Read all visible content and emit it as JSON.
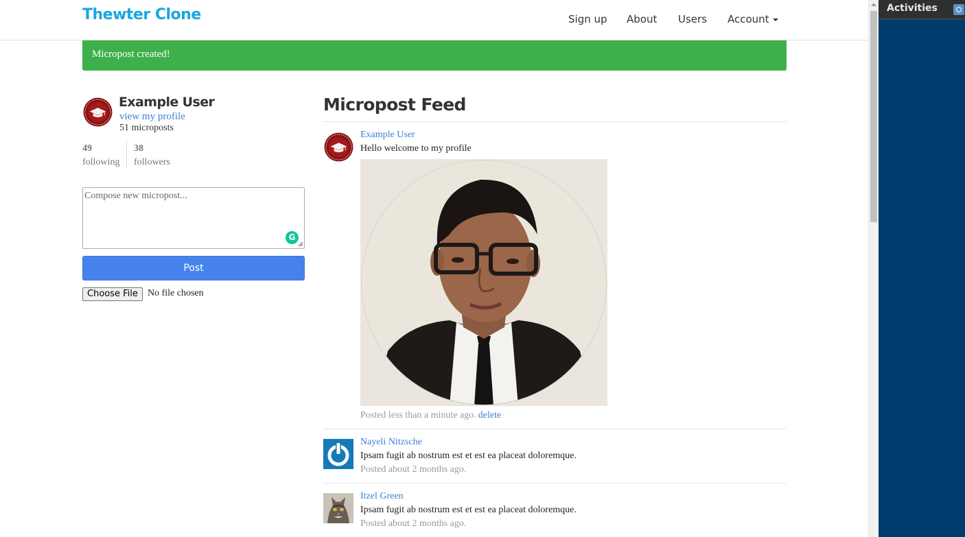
{
  "navbar": {
    "brand": "Thewter Clone",
    "links": {
      "signup": "Sign up",
      "about": "About",
      "users": "Users",
      "account": "Account"
    }
  },
  "alert": {
    "message": "Micropost created!"
  },
  "sidebar": {
    "user_name": "Example User",
    "profile_link": "view my profile",
    "micropost_count": "51 microposts",
    "following_count": "49",
    "following_label": "following",
    "followers_count": "38",
    "followers_label": "followers"
  },
  "composer": {
    "placeholder": "Compose new micropost...",
    "post_label": "Post",
    "choose_file_label": "Choose File",
    "file_status": "No file chosen"
  },
  "feed": {
    "title": "Micropost Feed",
    "items": [
      {
        "user": "Example User",
        "content": "Hello welcome to my profile",
        "time": "Posted less than a minute ago.",
        "delete_label": "delete",
        "has_image": true
      },
      {
        "user": "Nayeli Nitzsche",
        "content": "Ipsam fugit ab nostrum est et est ea placeat doloremque.",
        "time": "Posted about 2 months ago."
      },
      {
        "user": "Itzel Green",
        "content": "Ipsam fugit ab nostrum est et est ea placeat doloremque.",
        "time": "Posted about 2 months ago."
      }
    ]
  },
  "side_panel": {
    "title": "Activities"
  },
  "colors": {
    "brand": "#1aa7e0",
    "alert": "#3eb04b",
    "primary_button": "#4582ec",
    "link": "#3b80d5",
    "panel": "#003d6f"
  },
  "icons": {
    "user_avatar": "graduation-cap-badge-icon",
    "grammarly": "grammarly-icon",
    "nayeli_avatar": "power-icon",
    "itzel_avatar": "cat-photo"
  }
}
